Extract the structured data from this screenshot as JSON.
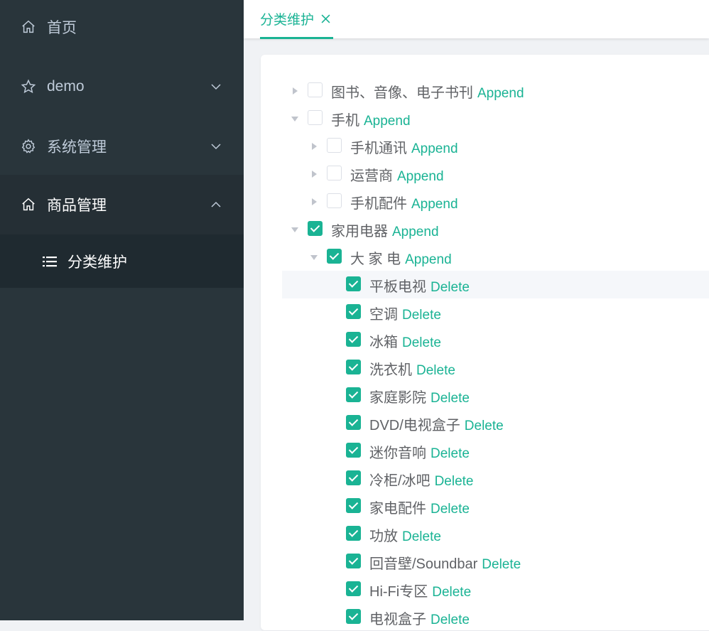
{
  "sidebar": {
    "items": [
      {
        "label": "首页",
        "icon": "home-icon"
      },
      {
        "label": "demo",
        "icon": "star-icon"
      },
      {
        "label": "系统管理",
        "icon": "gear-icon"
      },
      {
        "label": "商品管理",
        "icon": "home-icon"
      }
    ],
    "sub_item": {
      "label": "分类维护",
      "icon": "list-icon"
    }
  },
  "tab": {
    "label": "分类维护"
  },
  "tree": {
    "append_label": "Append",
    "delete_label": "Delete",
    "nodes": [
      {
        "label": "图书、音像、电子书刊",
        "level": 0,
        "expand": "right",
        "checked": false,
        "action": "Append"
      },
      {
        "label": "手机",
        "level": 0,
        "expand": "down",
        "checked": false,
        "action": "Append"
      },
      {
        "label": "手机通讯",
        "level": 1,
        "expand": "right",
        "checked": false,
        "action": "Append"
      },
      {
        "label": "运营商",
        "level": 1,
        "expand": "right",
        "checked": false,
        "action": "Append"
      },
      {
        "label": "手机配件",
        "level": 1,
        "expand": "right",
        "checked": false,
        "action": "Append"
      },
      {
        "label": "家用电器",
        "level": 0,
        "expand": "down",
        "checked": true,
        "action": "Append"
      },
      {
        "label": "大 家 电",
        "level": 1,
        "expand": "down",
        "checked": true,
        "action": "Append"
      },
      {
        "label": "平板电视",
        "level": 2,
        "expand": "none",
        "checked": true,
        "action": "Delete",
        "hover": true
      },
      {
        "label": "空调",
        "level": 2,
        "expand": "none",
        "checked": true,
        "action": "Delete"
      },
      {
        "label": "冰箱",
        "level": 2,
        "expand": "none",
        "checked": true,
        "action": "Delete"
      },
      {
        "label": "洗衣机",
        "level": 2,
        "expand": "none",
        "checked": true,
        "action": "Delete"
      },
      {
        "label": "家庭影院",
        "level": 2,
        "expand": "none",
        "checked": true,
        "action": "Delete"
      },
      {
        "label": "DVD/电视盒子",
        "level": 2,
        "expand": "none",
        "checked": true,
        "action": "Delete"
      },
      {
        "label": "迷你音响",
        "level": 2,
        "expand": "none",
        "checked": true,
        "action": "Delete"
      },
      {
        "label": "冷柜/冰吧",
        "level": 2,
        "expand": "none",
        "checked": true,
        "action": "Delete"
      },
      {
        "label": "家电配件",
        "level": 2,
        "expand": "none",
        "checked": true,
        "action": "Delete"
      },
      {
        "label": "功放",
        "level": 2,
        "expand": "none",
        "checked": true,
        "action": "Delete"
      },
      {
        "label": "回音壁/Soundbar",
        "level": 2,
        "expand": "none",
        "checked": true,
        "action": "Delete"
      },
      {
        "label": "Hi-Fi专区",
        "level": 2,
        "expand": "none",
        "checked": true,
        "action": "Delete"
      },
      {
        "label": "电视盒子",
        "level": 2,
        "expand": "none",
        "checked": true,
        "action": "Delete"
      }
    ]
  },
  "colors": {
    "accent": "#1ab394",
    "sidebar_bg": "#29353b",
    "text": "#606266"
  }
}
